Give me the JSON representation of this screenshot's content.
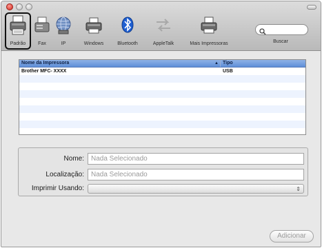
{
  "toolbar": {
    "items": [
      {
        "label": "Padrão",
        "icon": "printer-icon",
        "selected": true
      },
      {
        "label": "Fax",
        "icon": "fax-icon"
      },
      {
        "label": "IP",
        "icon": "globe-icon"
      },
      {
        "label": "Windows",
        "icon": "windows-printer-icon"
      },
      {
        "label": "Bluetooth",
        "icon": "bluetooth-icon"
      },
      {
        "label": "AppleTalk",
        "icon": "appletalk-icon"
      },
      {
        "label": "Mais Impressoras",
        "icon": "more-printers-icon"
      }
    ],
    "search_label": "Buscar",
    "search_placeholder": ""
  },
  "printer_list": {
    "columns": [
      "Nome da Impressora",
      "Tipo"
    ],
    "rows": [
      [
        "Brother MFC- XXXX",
        "USB"
      ]
    ]
  },
  "details": {
    "name_label": "Nome:",
    "name_value": "Nada Selecionado",
    "location_label": "Localização:",
    "location_value": "Nada Selecionado",
    "print_using_label": "Imprimir Usando:",
    "print_using_value": ""
  },
  "footer": {
    "add_label": "Adicionar"
  },
  "colors": {
    "header_blue": "#6a97da",
    "row_stripe": "#edf3fe",
    "bluetooth_blue": "#1f5fd1"
  }
}
